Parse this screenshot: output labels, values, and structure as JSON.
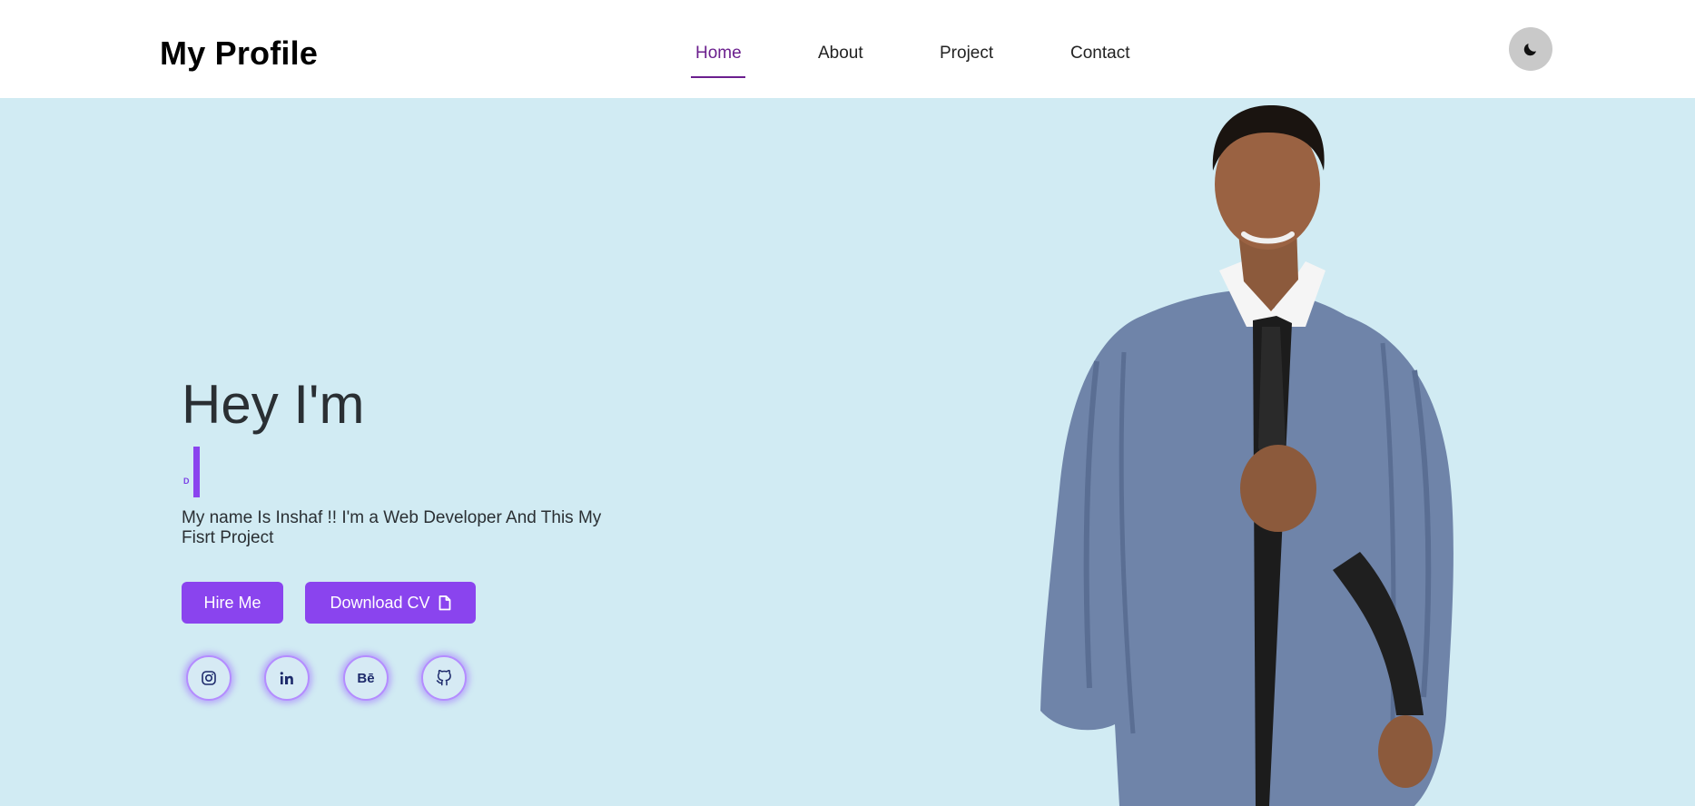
{
  "header": {
    "logo": "My Profile",
    "nav": [
      {
        "label": "Home",
        "active": true
      },
      {
        "label": "About",
        "active": false
      },
      {
        "label": "Project",
        "active": false
      },
      {
        "label": "Contact",
        "active": false
      }
    ],
    "theme_toggle_icon": "moon-icon"
  },
  "hero": {
    "greeting": "Hey I'm",
    "typed_text": "D",
    "intro": "My name Is Inshaf !! I'm a Web Developer And This My Fisrt Project",
    "hire_label": "Hire Me",
    "download_label": "Download CV",
    "download_icon": "file-icon",
    "socials": [
      {
        "name": "instagram-icon"
      },
      {
        "name": "linkedin-icon"
      },
      {
        "name": "behance-icon",
        "text": "Bē"
      },
      {
        "name": "github-icon"
      }
    ]
  },
  "colors": {
    "background": "#d1ebf3",
    "accent": "#8a44ee",
    "active_nav": "#6b1f8e",
    "header": "#ffffff",
    "icon": "#1d2a6b"
  }
}
